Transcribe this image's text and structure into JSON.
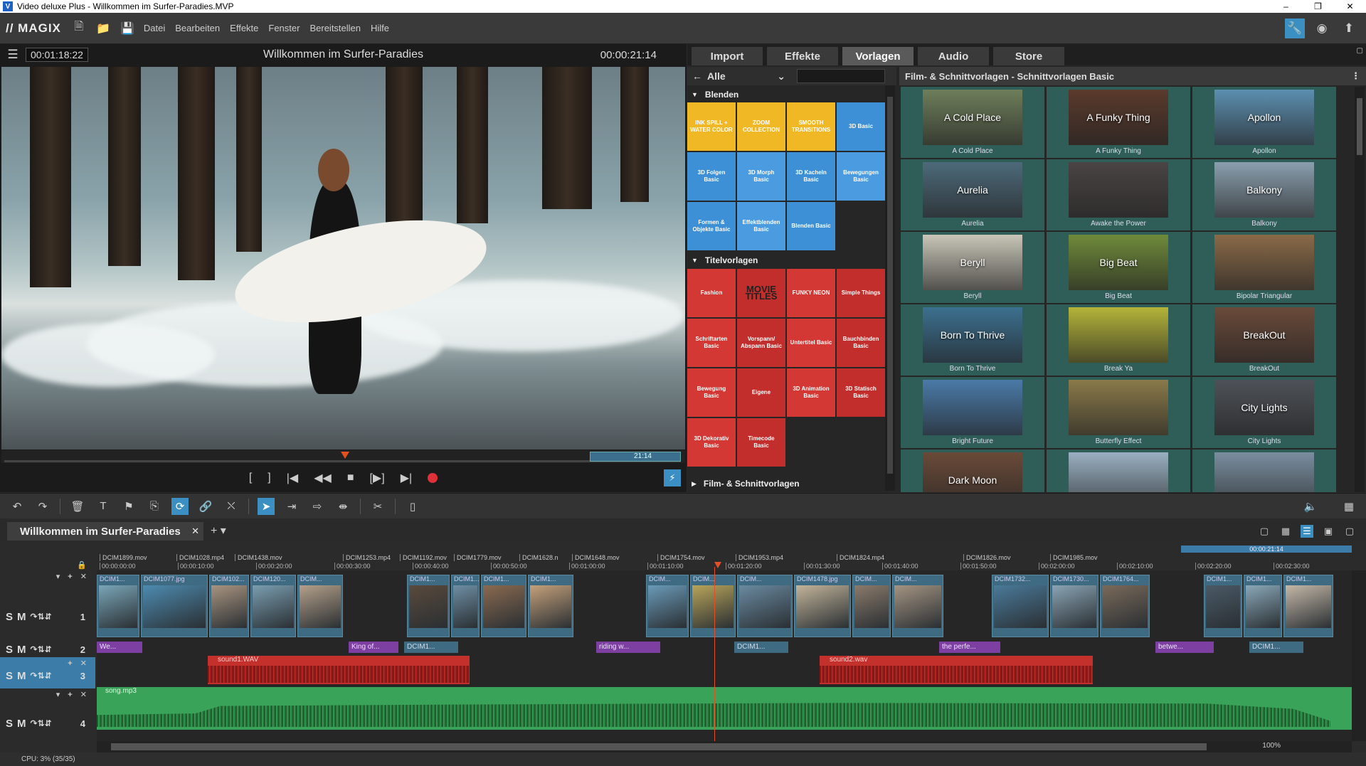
{
  "window": {
    "title": "Video deluxe Plus - Willkommen im Surfer-Paradies.MVP",
    "controls": [
      "–",
      "❐",
      "✕"
    ]
  },
  "menubar": {
    "logo": "// MAGIX",
    "items": [
      "Datei",
      "Bearbeiten",
      "Effekte",
      "Fenster",
      "Bereitstellen",
      "Hilfe"
    ]
  },
  "preview": {
    "timecode": "00:01:18:22",
    "title": "Willkommen im Surfer-Paradies",
    "duration": "00:00:21:14",
    "end_marker": "21:14"
  },
  "media": {
    "tabs": [
      "Import",
      "Effekte",
      "Vorlagen",
      "Audio",
      "Store"
    ],
    "active_tab": "Vorlagen",
    "filter": "Alle",
    "category_blenden": "Blenden",
    "blenden_tiles": [
      {
        "label": "INK SPILL + WATER COLOR",
        "color": "yellow"
      },
      {
        "label": "ZOOM COLLECTION",
        "color": "yellow"
      },
      {
        "label": "SMOOTH TRANSITIONS",
        "color": "yellow"
      },
      {
        "label": "3D Basic",
        "color": "blue"
      },
      {
        "label": "3D Folgen Basic",
        "color": "blue"
      },
      {
        "label": "3D Morph Basic",
        "color": "blue2"
      },
      {
        "label": "3D Kacheln Basic",
        "color": "blue"
      },
      {
        "label": "Bewegungen Basic",
        "color": "blue2"
      },
      {
        "label": "Formen & Objekte Basic",
        "color": "blue"
      },
      {
        "label": "Effektblenden Basic",
        "color": "blue2"
      },
      {
        "label": "Blenden Basic",
        "color": "blue"
      }
    ],
    "category_titel": "Titelvorlagen",
    "titel_tiles": [
      {
        "label": "Fashion",
        "color": "red"
      },
      {
        "label": "MOVIE TITLES",
        "color": "red2"
      },
      {
        "label": "FUNKY NEON",
        "color": "red"
      },
      {
        "label": "Simple Things",
        "color": "red2"
      },
      {
        "label": "Schriftarten Basic",
        "color": "red"
      },
      {
        "label": "Vorspann/ Abspann Basic",
        "color": "red2"
      },
      {
        "label": "Untertitel Basic",
        "color": "red"
      },
      {
        "label": "Bauchbinden Basic",
        "color": "red2"
      },
      {
        "label": "Bewegung Basic",
        "color": "red"
      },
      {
        "label": "Eigene",
        "color": "red2"
      },
      {
        "label": "3D Animation Basic",
        "color": "red"
      },
      {
        "label": "3D Statisch Basic",
        "color": "red2"
      },
      {
        "label": "3D Dekorativ Basic",
        "color": "red"
      },
      {
        "label": "Timecode Basic",
        "color": "red2"
      }
    ],
    "category_film": "Film- & Schnittvorlagen",
    "right_header": "Film- & Schnittvorlagen - Schnittvorlagen Basic",
    "templates": [
      {
        "name": "A Cold Place",
        "overlay": "A Cold Place",
        "bg": "#6e7e5a"
      },
      {
        "name": "A Funky Thing",
        "overlay": "A Funky Thing",
        "bg": "#5a3a2c"
      },
      {
        "name": "Apollon",
        "overlay": "Apollon",
        "bg": "#5c8fb0"
      },
      {
        "name": "Aurelia",
        "overlay": "Aurelia",
        "bg": "#4d6a7a"
      },
      {
        "name": "Awake the Power",
        "overlay": "",
        "bg": "#4a4444"
      },
      {
        "name": "Balkony",
        "overlay": "Balkony",
        "bg": "#8a9fae"
      },
      {
        "name": "Beryll",
        "overlay": "Beryll",
        "bg": "#c9c6b8"
      },
      {
        "name": "Big Beat",
        "overlay": "Big Beat",
        "bg": "#6f8a3a"
      },
      {
        "name": "Bipolar Triangular",
        "overlay": "",
        "bg": "#8a6a48"
      },
      {
        "name": "Born To Thrive",
        "overlay": "Born To Thrive",
        "bg": "#3c7090"
      },
      {
        "name": "Break Ya",
        "overlay": "",
        "bg": "#b4b43a"
      },
      {
        "name": "BreakOut",
        "overlay": "BreakOut",
        "bg": "#6a4a3a"
      },
      {
        "name": "Bright Future",
        "overlay": "",
        "bg": "#4a7aa8"
      },
      {
        "name": "Butterfly Effect",
        "overlay": "",
        "bg": "#8a7a4a"
      },
      {
        "name": "City Lights",
        "overlay": "City Lights",
        "bg": "#4e5258"
      },
      {
        "name": "",
        "overlay": "Dark Moon",
        "bg": "#6a4a38"
      },
      {
        "name": "",
        "overlay": "",
        "bg": "#9ab0c2"
      },
      {
        "name": "",
        "overlay": "",
        "bg": "#7a8ea0"
      }
    ]
  },
  "timeline": {
    "project_tab": "Willkommen im Surfer-Paradies",
    "range_label": "00:00:21:14",
    "clip_names": [
      "DCIM1899.mov",
      "DCIM1028.mp4",
      "DCIM1438.mov",
      "DCIM1253.mp4",
      "DCIM1192.mov",
      "DCIM1779.mov",
      "DCIM1628.n",
      "DCIM1648.mov",
      "DCIM1754.mov",
      "DCIM1953.mp4",
      "DCIM1824.mp4",
      "DCIM1826.mov",
      "DCIM1985.mov"
    ],
    "ticks": [
      "00:00:00:00",
      "00:00:10:00",
      "00:00:20:00",
      "00:00:30:00",
      "00:00:40:00",
      "00:00:50:00",
      "00:01:00:00",
      "00:01:10:00",
      "00:01:20:00",
      "00:01:30:00",
      "00:01:40:00",
      "00:01:50:00",
      "00:02:00:00",
      "00:02:10:00",
      "00:02:20:00",
      "00:02:30:00"
    ],
    "tracks": [
      {
        "num": "1",
        "S": "S",
        "M": "M"
      },
      {
        "num": "2",
        "S": "S",
        "M": "M"
      },
      {
        "num": "3",
        "S": "S",
        "M": "M"
      },
      {
        "num": "4",
        "S": "S",
        "M": "M"
      }
    ],
    "video_clips": [
      {
        "label": "DCIM1...",
        "bg": "#7aa6b8"
      },
      {
        "label": "DCIM1077.jpg",
        "bg": "#4d8bb0"
      },
      {
        "label": "DCIM102...",
        "bg": "#a89480"
      },
      {
        "label": "DCIM120...",
        "bg": "#7a9eb0"
      },
      {
        "label": "DCIM...",
        "bg": "#b4a08a"
      },
      {
        "label": "DCIM1...",
        "bg": "#5a4a3c"
      },
      {
        "label": "DCIM1...",
        "bg": "#6e8ea4"
      },
      {
        "label": "DCIM1...",
        "bg": "#8a6a50"
      },
      {
        "label": "DCIM1...",
        "bg": "#c4a07a"
      },
      {
        "label": "DCIM...",
        "bg": "#6a9ab8"
      },
      {
        "label": "DCIM...",
        "bg": "#b8a45a"
      },
      {
        "label": "DCIM...",
        "bg": "#6a8aa0"
      },
      {
        "label": "DCIM1478.jpg",
        "bg": "#c2b49a"
      },
      {
        "label": "DCIM...",
        "bg": "#8a7a6a"
      },
      {
        "label": "DCIM...",
        "bg": "#a49482"
      },
      {
        "label": "DCIM1732...",
        "bg": "#4a7a9a"
      },
      {
        "label": "DCIM1730...",
        "bg": "#8aa4b4"
      },
      {
        "label": "DCIM1764...",
        "bg": "#7a6a5a"
      },
      {
        "label": "DCIM1...",
        "bg": "#4a5a66"
      },
      {
        "label": "DCIM1...",
        "bg": "#8aa8b8"
      },
      {
        "label": "DCIM1...",
        "bg": "#c4b8a8"
      }
    ],
    "title_clips": [
      "We...",
      "King of...",
      "DCIM1...",
      "riding w...",
      "DCIM1...",
      "the perfe...",
      "betwe...",
      "DCIM1..."
    ],
    "audio_clips": [
      "sound1.WAV",
      "sound2.wav"
    ],
    "music": "song.mp3",
    "zoom": "100%"
  },
  "status": {
    "cpu": "CPU: 3% (35/35)"
  },
  "colors": {
    "accent": "#3c8fc2",
    "audio": "#c4302c",
    "music": "#3aa35a",
    "title_clip": "#7d3fa1",
    "playhead": "#e2502a"
  }
}
